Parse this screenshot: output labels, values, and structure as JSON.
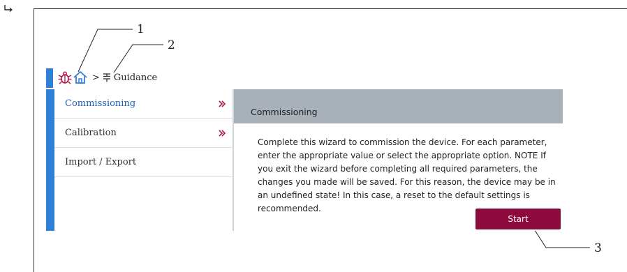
{
  "callouts": [
    "1",
    "2",
    "3"
  ],
  "breadcrumb": {
    "separator": ">",
    "current": "Guidance"
  },
  "nav": {
    "items": [
      {
        "label": "Commissioning",
        "has_submenu": true,
        "active": true
      },
      {
        "label": "Calibration",
        "has_submenu": true,
        "active": false
      },
      {
        "label": "Import / Export",
        "has_submenu": false,
        "active": false
      }
    ]
  },
  "content": {
    "title": "Commissioning",
    "description": "Complete this wizard to commission the device. For each parameter, enter the appropriate value or select the appropriate option. NOTE If you exit the wizard before completing all required parameters, the changes you made will be saved. For this reason, the device may be in an undefined state! In this case, a reset to the default settings is recommended.",
    "start_label": "Start"
  },
  "colors": {
    "accent_blue": "#2f7fd6",
    "brand_red": "#8c0a3c",
    "header_gray": "#a8b0b8"
  },
  "icons": [
    "corner-arrow-icon",
    "bug-icon",
    "home-icon",
    "guidance-icon",
    "chevron-right-icon"
  ]
}
